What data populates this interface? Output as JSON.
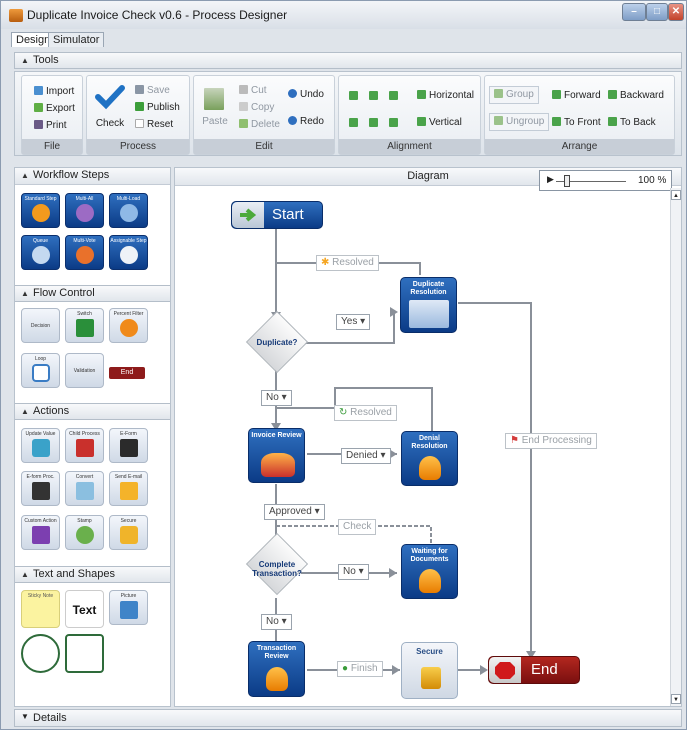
{
  "window": {
    "title": "Duplicate Invoice Check v0.6 - Process Designer"
  },
  "tabs": [
    {
      "label": "Design"
    },
    {
      "label": "Simulator"
    }
  ],
  "tools_panel": {
    "title": "Tools"
  },
  "ribbon": {
    "file": {
      "footer": "File",
      "import": "Import",
      "export": "Export",
      "print": "Print"
    },
    "process": {
      "footer": "Process",
      "check": "Check",
      "save": "Save",
      "publish": "Publish",
      "reset": "Reset"
    },
    "edit": {
      "footer": "Edit",
      "paste": "Paste",
      "cut": "Cut",
      "copy": "Copy",
      "delete": "Delete",
      "undo": "Undo",
      "redo": "Redo"
    },
    "alignment": {
      "footer": "Alignment",
      "horizontal": "Horizontal",
      "vertical": "Vertical"
    },
    "arrange": {
      "footer": "Arrange",
      "group": "Group",
      "ungroup": "Ungroup",
      "forward": "Forward",
      "backward": "Backward",
      "to_front": "To Front",
      "to_back": "To Back"
    }
  },
  "sidebar": {
    "workflow_steps": {
      "title": "Workflow Steps",
      "items": [
        "Standard Step",
        "Multi-All",
        "Multi-Load",
        "Queue",
        "Multi-Vote",
        "Assignable Step"
      ]
    },
    "flow_control": {
      "title": "Flow Control",
      "items": [
        "Decision",
        "Switch",
        "Percent Filter",
        "Loop",
        "Validation",
        "End"
      ]
    },
    "actions": {
      "title": "Actions",
      "items": [
        "Update Value",
        "Child Process",
        "E-Form",
        "E-form Proc.",
        "Convert",
        "Send E-mail",
        "Custom Action",
        "Stamp",
        "Secure"
      ]
    },
    "text_shapes": {
      "title": "Text and Shapes",
      "sticky": "Sticky Note",
      "text": "Text",
      "picture": "Picture"
    }
  },
  "diagram": {
    "header": "Diagram",
    "zoom": "100 %",
    "start": "Start",
    "end": "End",
    "nodes": {
      "duplicate_resolution": "Duplicate Resolution",
      "invoice_review": "Invoice Review",
      "denial_resolution": "Denial Resolution",
      "waiting_for_documents": "Waiting for Documents",
      "transaction_review": "Transaction Review",
      "secure": "Secure"
    },
    "decisions": {
      "duplicate": "Duplicate?",
      "complete_transaction": "Complete Transaction?"
    },
    "labels": {
      "resolved_1": "Resolved",
      "yes": "Yes",
      "no_1": "No",
      "resolved_2": "Resolved",
      "denied": "Denied",
      "end_processing": "End Processing",
      "approved": "Approved",
      "check": "Check",
      "no_2": "No",
      "no_3": "No",
      "finish": "Finish"
    }
  },
  "details": {
    "title": "Details"
  }
}
